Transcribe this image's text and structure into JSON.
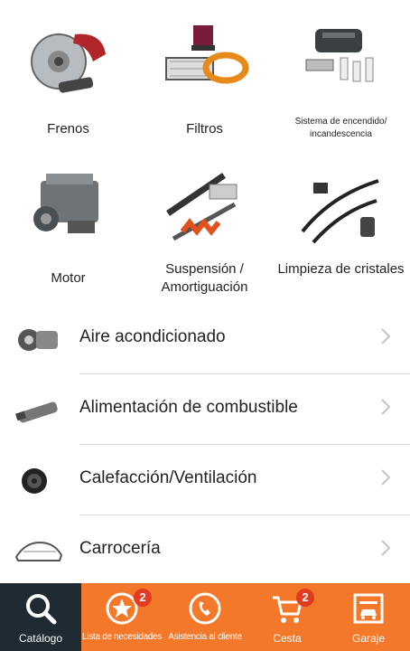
{
  "categories_grid": [
    {
      "label": "Frenos",
      "icon": "brakes-icon"
    },
    {
      "label": "Filtros",
      "icon": "filters-icon"
    },
    {
      "label": "Sistema de encendido/ incandescencia",
      "icon": "ignition-icon"
    },
    {
      "label": "Motor",
      "icon": "engine-icon"
    },
    {
      "label": "Suspensión / Amortiguación",
      "icon": "suspension-icon"
    },
    {
      "label": "Limpieza de cristales",
      "icon": "wipers-icon"
    }
  ],
  "categories_list": [
    {
      "label": "Aire acondicionado",
      "icon": "ac-compressor-icon"
    },
    {
      "label": "Alimentación de combustible",
      "icon": "fuel-pump-icon"
    },
    {
      "label": "Calefacción/Ventilación",
      "icon": "blower-fan-icon"
    },
    {
      "label": "Carrocería",
      "icon": "body-parts-icon"
    }
  ],
  "tabbar": {
    "catalog": {
      "label": "Catálogo",
      "icon": "search-icon"
    },
    "wishlist": {
      "label": "Lista de necesidades",
      "icon": "star-icon",
      "badge": "2"
    },
    "support": {
      "label": "Asistencia al cliente",
      "icon": "phone-icon"
    },
    "cart": {
      "label": "Cesta",
      "icon": "cart-icon",
      "badge": "2"
    },
    "garage": {
      "label": "Garaje",
      "icon": "garage-icon"
    }
  },
  "colors": {
    "accent": "#f4782a",
    "active_tab": "#1e2b33",
    "badge": "#e23b22"
  }
}
